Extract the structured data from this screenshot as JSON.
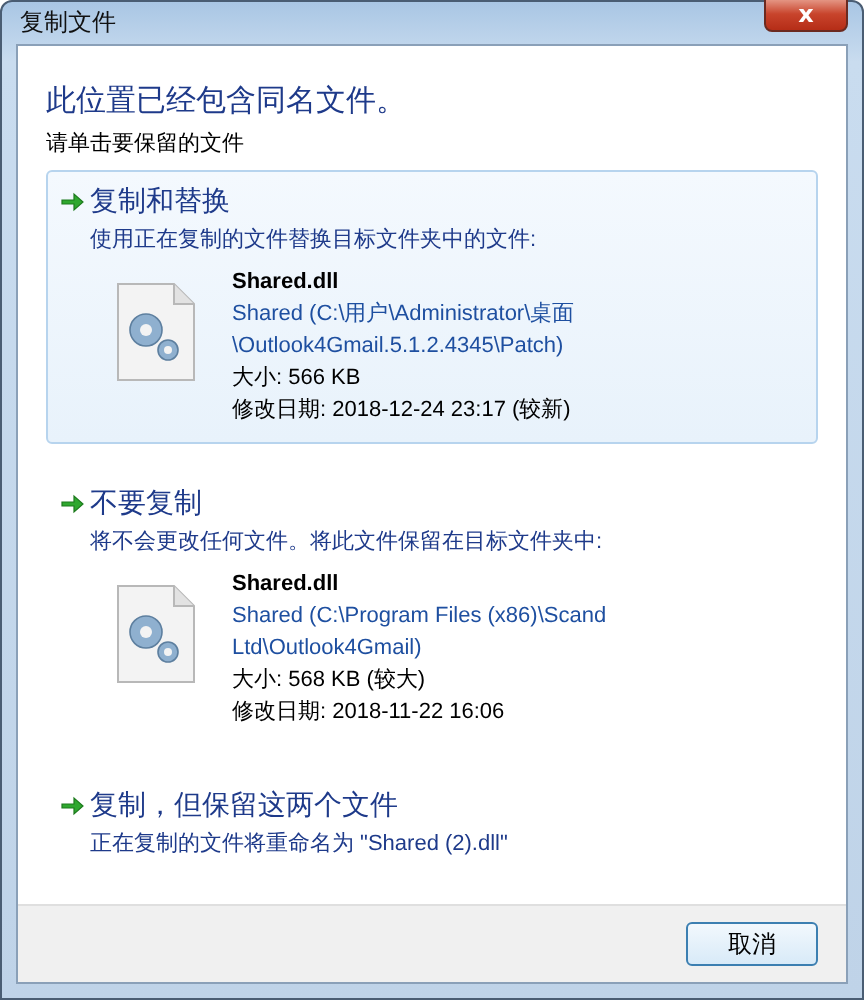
{
  "window": {
    "title": "复制文件",
    "close": "x"
  },
  "heading": "此位置已经包含同名文件。",
  "instruction": "请单击要保留的文件",
  "options": [
    {
      "kind": "file",
      "selected": true,
      "title": "复制和替换",
      "description": "使用正在复制的文件替换目标文件夹中的文件:",
      "file": {
        "name": "Shared.dll",
        "path_lines": [
          "Shared (C:\\用户\\Administrator\\桌面",
          "\\Outlook4Gmail.5.1.2.4345\\Patch)"
        ],
        "size": "大小: 566 KB",
        "date": "修改日期: 2018-12-24 23:17 (较新)"
      }
    },
    {
      "kind": "file",
      "selected": false,
      "title": "不要复制",
      "description": "将不会更改任何文件。将此文件保留在目标文件夹中:",
      "file": {
        "name": "Shared.dll",
        "path_lines": [
          "Shared (C:\\Program Files (x86)\\Scand",
          "Ltd\\Outlook4Gmail)"
        ],
        "size": "大小: 568 KB (较大)",
        "date": "修改日期: 2018-11-22 16:06"
      }
    },
    {
      "kind": "plain",
      "selected": false,
      "title": "复制，但保留这两个文件",
      "description": "正在复制的文件将重命名为 \"Shared (2).dll\""
    }
  ],
  "buttons": [
    {
      "label": "取消"
    }
  ]
}
